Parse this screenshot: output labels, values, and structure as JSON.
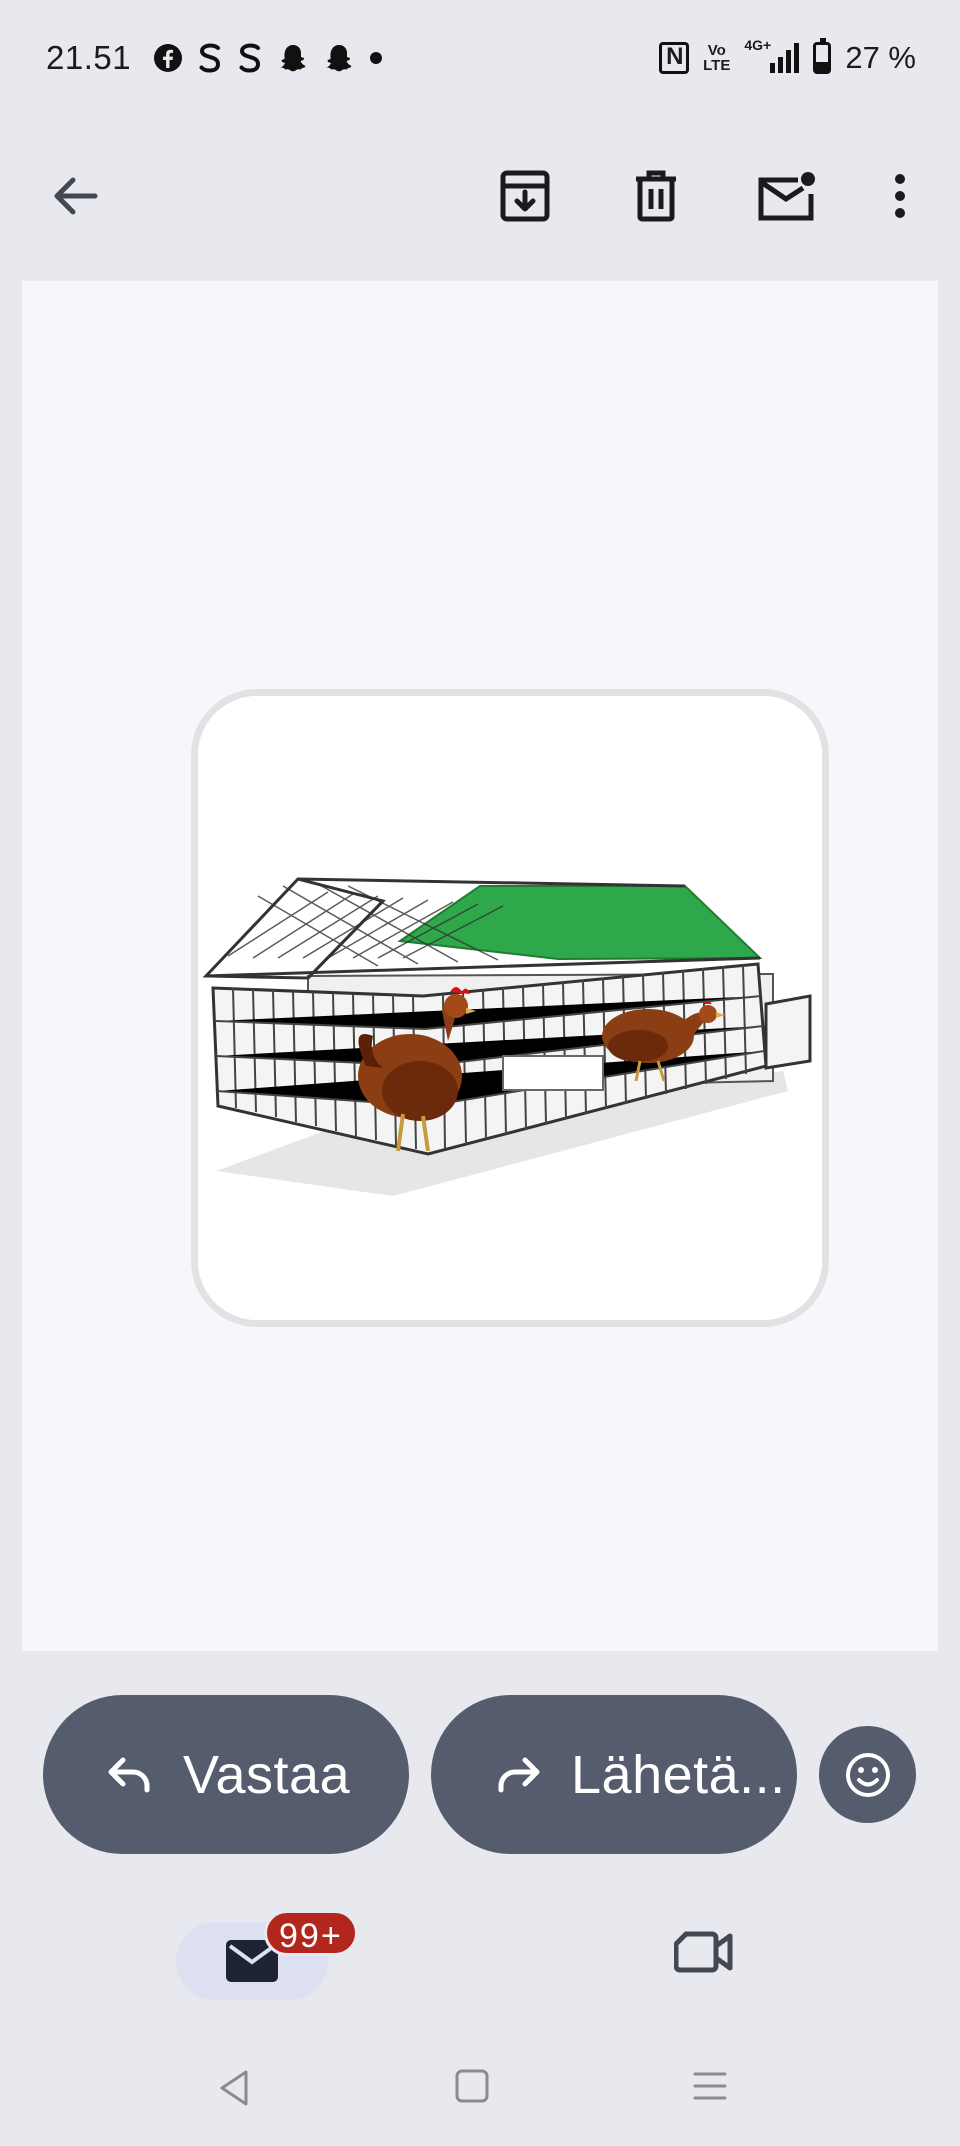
{
  "status_bar": {
    "time": "21.51",
    "notification_icons": [
      "facebook-icon",
      "s-icon",
      "s-icon",
      "snapchat-icon",
      "snapchat-icon",
      "dot-icon"
    ],
    "volte_line1": "Vo",
    "volte_line2": "LTE",
    "network": "4G+",
    "battery_percent": "27 %"
  },
  "app_bar": {
    "icons": [
      "back-arrow-icon",
      "archive-icon",
      "delete-icon",
      "mark-unread-icon",
      "more-vert-icon"
    ]
  },
  "attachment": {
    "icon": "chicken-coop-image"
  },
  "actions": {
    "reply_label": "Vastaa",
    "forward_label": "Lähetä...",
    "emoji": "emoji-reaction-icon"
  },
  "bottom_nav": {
    "mail_badge": "99+",
    "tabs": [
      "mail-icon",
      "meet-video-icon"
    ]
  },
  "colors": {
    "button_bg": "#555c6e",
    "badge_bg": "#b3261e",
    "roof_green": "#2ea84a"
  }
}
